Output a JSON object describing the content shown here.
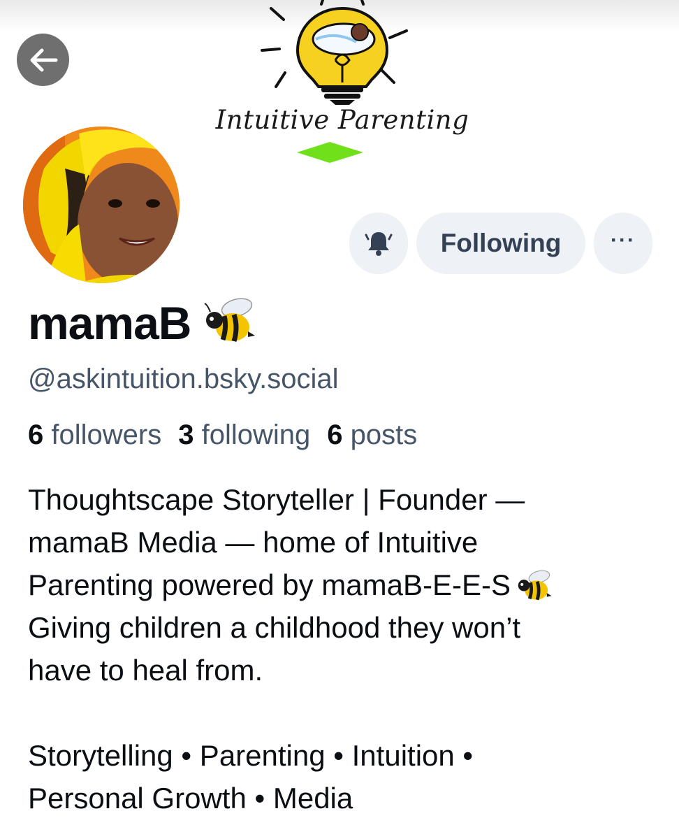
{
  "banner": {
    "logo_text": "Intuitive Parenting"
  },
  "nav": {
    "back_icon": "arrow-left-icon"
  },
  "actions": {
    "notify_icon": "bell-icon",
    "follow_label": "Following",
    "more_label": "···"
  },
  "profile": {
    "display_name": "mamaB",
    "name_emoji": "bee-icon",
    "handle": "@askintuition.bsky.social",
    "stats": {
      "followers_count": "6",
      "followers_label": "followers",
      "following_count": "3",
      "following_label": "following",
      "posts_count": "6",
      "posts_label": "posts"
    },
    "bio_lines": [
      "Thoughtscape Storyteller | Founder —",
      "mamaB Media —  home of Intuitive",
      "Parenting powered by mamaB-E-E-S",
      "Giving children a childhood they won’t",
      "have to heal from.",
      "",
      "Storytelling • Parenting • Intuition •",
      "Personal Growth • Media"
    ]
  },
  "colors": {
    "button_bg": "#eef1f5",
    "button_text": "#344155",
    "muted_text": "#475569",
    "primary_text": "#0b0f14",
    "logo_yellow": "#f7d11f",
    "logo_green": "#6fe01a"
  }
}
